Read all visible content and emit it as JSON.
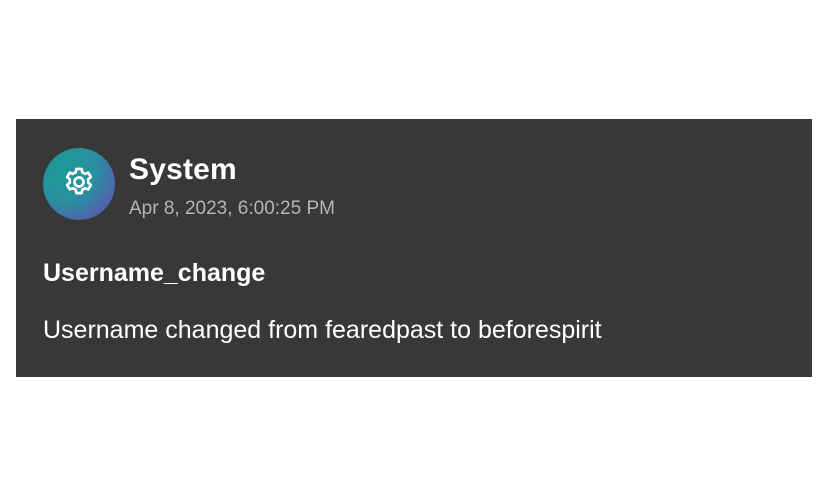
{
  "notification": {
    "sender": "System",
    "timestamp": "Apr 8, 2023, 6:00:25 PM",
    "title": "Username_change",
    "message": "Username changed from fearedpast to beforespirit",
    "avatar_icon": "gear-icon"
  },
  "colors": {
    "card_background": "#383838",
    "primary_text": "#ffffff",
    "secondary_text": "#b5b5b5",
    "avatar_gradient_start": "#1a9a94",
    "avatar_gradient_end": "#6a4cb6"
  }
}
